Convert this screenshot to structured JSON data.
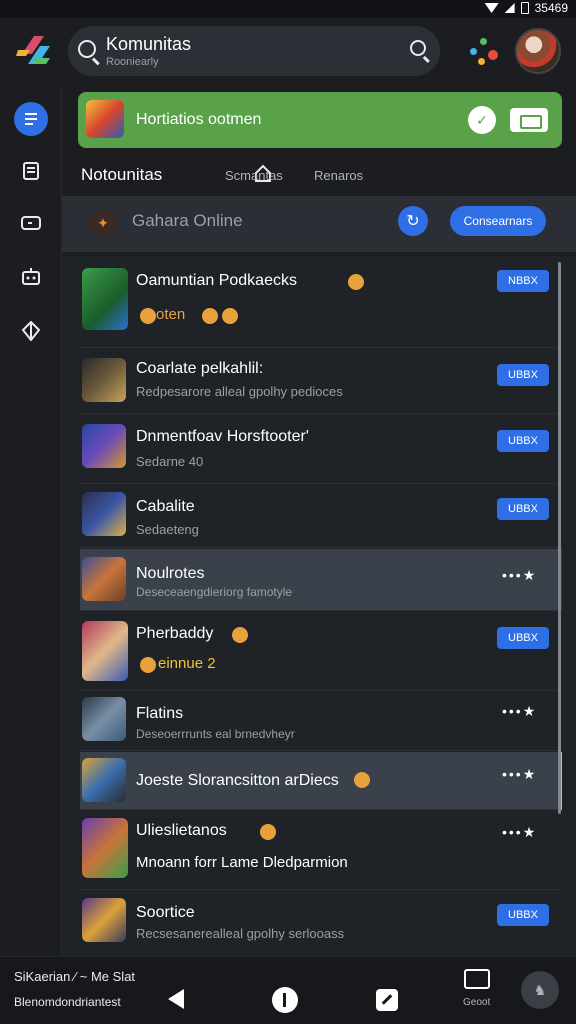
{
  "status": {
    "time": "35469"
  },
  "header": {
    "search_title": "Komunitas",
    "search_sub": "Rooniearly"
  },
  "banner": {
    "text": "Hortiatios ootmen"
  },
  "tabs": {
    "main": "Notounitas",
    "tab2": "Scmantas",
    "tab3": "Renaros"
  },
  "section": {
    "title": "Gahara Online",
    "button": "Consearnars"
  },
  "rows": [
    {
      "title": "Oamuntian Podkaecks",
      "sub": "oten",
      "badge": "NBBX"
    },
    {
      "title": "Coarlate pelkahlil:",
      "sub": "Redpesarore alleal gpolhy pedioces",
      "badge": "UBBX"
    },
    {
      "title": "Dnmentfoav Horsftooter'",
      "sub": "Sedarne 40",
      "badge": "UBBX"
    },
    {
      "title": "Cabalite",
      "sub": "Sedaeteng",
      "badge": "UBBX"
    },
    {
      "title": "Noulrotes",
      "sub": "Deseceaengdieriorg famotyle",
      "more": "•••★"
    },
    {
      "title": "Pherbaddy",
      "sub": "einnue 2",
      "badge": "UBBX"
    },
    {
      "title": "Flatins",
      "sub": "Deseoerrrunts eal brnedvheyr",
      "more": "•••★"
    },
    {
      "title": "Joeste Slorancsitton arDiecs",
      "more": "•••★"
    },
    {
      "title": "Ulieslietanos",
      "sub": "Mnoann forr Lame Dledparmion",
      "more": "•••★"
    },
    {
      "title": "Soortice",
      "sub": "Recsesanerealleal gpolhy serlooass",
      "badge": "UBBX"
    }
  ],
  "bottom": {
    "line1": "SiKaerian ⁄ ~ Me Slat",
    "line2": "Blenomdondriantest",
    "mail_label": "Geoot"
  }
}
